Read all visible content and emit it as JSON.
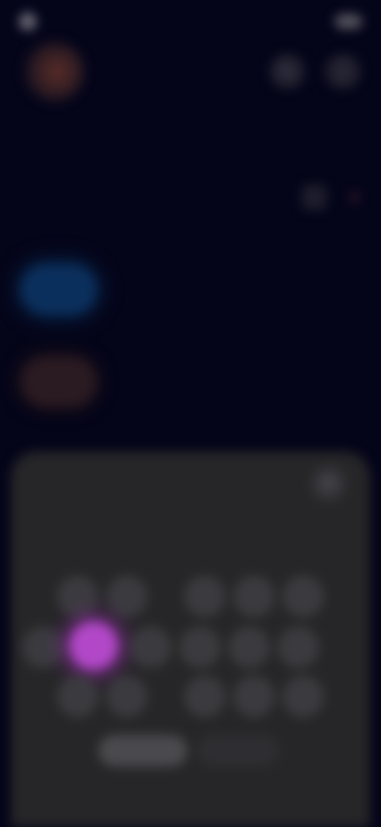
{
  "status_bar": {
    "time": "",
    "battery": ""
  },
  "header": {
    "title": "",
    "icons": [
      "search-icon",
      "more-icon"
    ]
  },
  "content": {
    "section_label": "",
    "description": ""
  },
  "sheet": {
    "title": "",
    "hint": "",
    "close_icon": "close-icon",
    "keys": [
      {
        "label": ""
      },
      {
        "label": ""
      },
      {
        "label": ""
      },
      {
        "label": ""
      },
      {
        "label": ""
      },
      {
        "label": ""
      },
      {
        "label": "",
        "selected": true
      },
      {
        "label": ""
      },
      {
        "label": ""
      },
      {
        "label": ""
      },
      {
        "label": ""
      },
      {
        "label": ""
      },
      {
        "label": ""
      },
      {
        "label": ""
      },
      {
        "label": ""
      },
      {
        "label": ""
      }
    ],
    "footer": {
      "primary_label": "",
      "secondary_label": ""
    }
  },
  "colors": {
    "background": "#05051a",
    "sheet": "#262628",
    "accent": "#b248c8",
    "chip_blue": "#0b2f5c"
  }
}
